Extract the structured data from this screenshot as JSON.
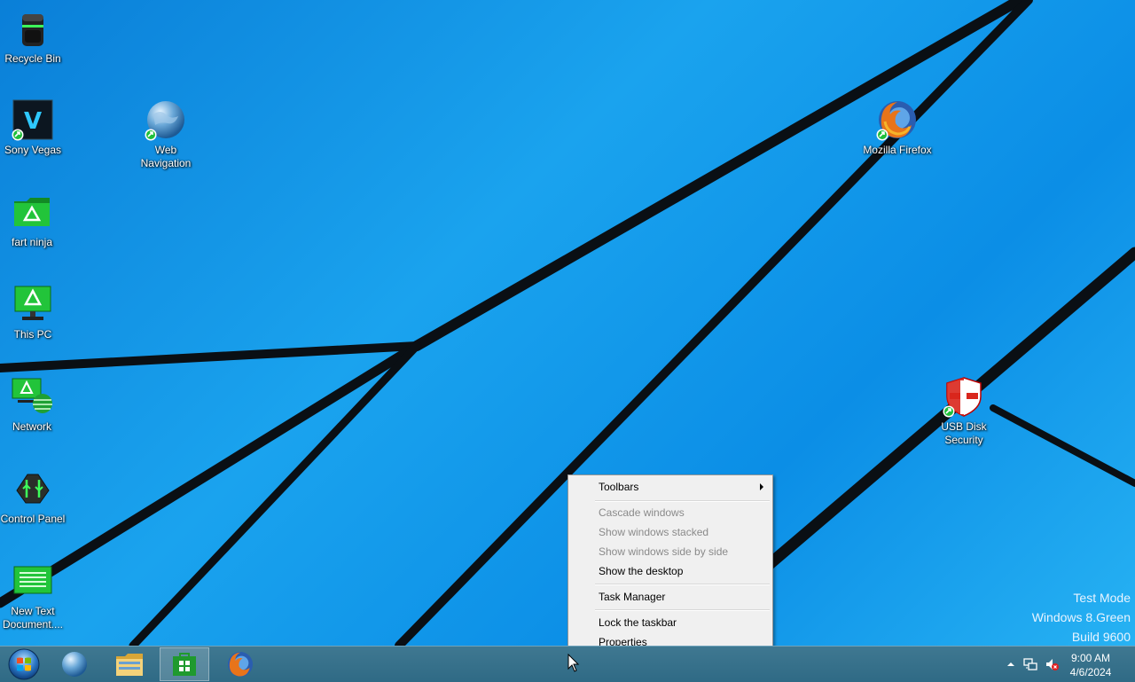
{
  "desktop": {
    "icons": [
      {
        "label": "Recycle Bin",
        "icon": "recycle-bin-icon"
      },
      {
        "label": "Sony Vegas",
        "icon": "sony-vegas-icon"
      },
      {
        "label": "Web Navigation",
        "icon": "web-globe-icon"
      },
      {
        "label": "fart ninja",
        "icon": "green-folder-icon"
      },
      {
        "label": "This PC",
        "icon": "this-pc-icon"
      },
      {
        "label": "Network",
        "icon": "network-icon"
      },
      {
        "label": "Control Panel",
        "icon": "control-panel-icon"
      },
      {
        "label": "New Text Document....",
        "icon": "text-document-icon"
      },
      {
        "label": "Mozilla Firefox",
        "icon": "firefox-icon"
      },
      {
        "label": "USB Disk Security",
        "icon": "usb-disk-security-icon"
      }
    ],
    "watermark": {
      "line1": "Test Mode",
      "line2": "Windows 8.Green",
      "line3": "Build 9600"
    }
  },
  "context_menu": {
    "items": [
      {
        "label": "Toolbars",
        "enabled": true,
        "submenu": true
      },
      {
        "label": "Cascade windows",
        "enabled": false
      },
      {
        "label": "Show windows stacked",
        "enabled": false
      },
      {
        "label": "Show windows side by side",
        "enabled": false
      },
      {
        "label": "Show the desktop",
        "enabled": true
      },
      {
        "label": "Task Manager",
        "enabled": true
      },
      {
        "label": "Lock the taskbar",
        "enabled": true
      },
      {
        "label": "Properties",
        "enabled": true
      }
    ]
  },
  "taskbar": {
    "pinned": [
      {
        "name": "start-orb-icon"
      },
      {
        "name": "web-globe-icon"
      },
      {
        "name": "file-explorer-icon"
      },
      {
        "name": "windows-store-icon",
        "active": true
      },
      {
        "name": "firefox-icon"
      }
    ],
    "tray": {
      "icons": [
        "show-hidden-icons-chevron-icon",
        "network-status-icon",
        "speaker-muted-icon"
      ],
      "time": "9:00 AM",
      "date": "4/6/2024"
    }
  },
  "colors": {
    "desktop_blue": "#0b8ee6",
    "taskbar": "#2f6a85",
    "icon_green": "#1fbf3a",
    "menu_bg": "#f0f0f0"
  }
}
